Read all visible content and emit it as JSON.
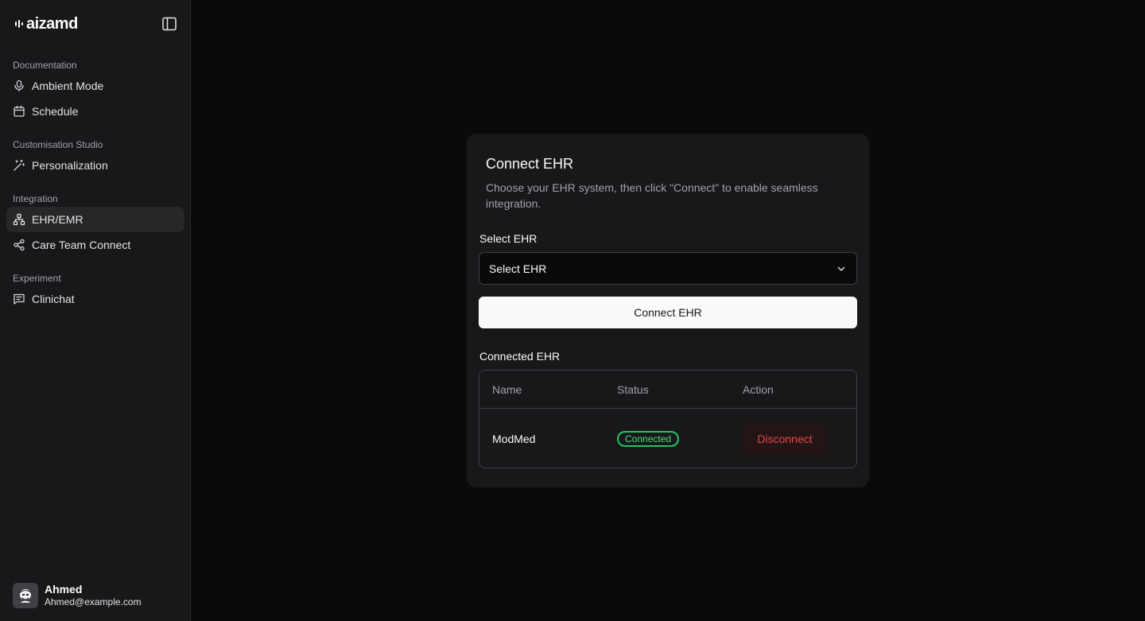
{
  "brand": {
    "name": "aizamd"
  },
  "sidebar": {
    "groups": [
      {
        "label": "Documentation",
        "items": [
          {
            "label": "Ambient Mode",
            "icon": "microphone-icon"
          },
          {
            "label": "Schedule",
            "icon": "calendar-icon"
          }
        ]
      },
      {
        "label": "Customisation Studio",
        "items": [
          {
            "label": "Personalization",
            "icon": "magic-wand-icon"
          }
        ]
      },
      {
        "label": "Integration",
        "items": [
          {
            "label": "EHR/EMR",
            "icon": "network-icon",
            "active": true
          },
          {
            "label": "Care Team Connect",
            "icon": "share-icon"
          }
        ]
      },
      {
        "label": "Experiment",
        "items": [
          {
            "label": "Clinichat",
            "icon": "chat-icon"
          }
        ]
      }
    ]
  },
  "user": {
    "name": "Ahmed",
    "email": "Ahmed@example.com"
  },
  "card": {
    "title": "Connect EHR",
    "description": "Choose your EHR system, then click \"Connect\" to enable seamless integration.",
    "select_label": "Select EHR",
    "select_value": "Select EHR",
    "connect_button": "Connect EHR",
    "connected_label": "Connected EHR",
    "table": {
      "headers": [
        "Name",
        "Status",
        "Action"
      ],
      "rows": [
        {
          "name": "ModMed",
          "status": "Connected",
          "action": "Disconnect"
        }
      ]
    }
  },
  "colors": {
    "accent_success": "#22c55e",
    "accent_danger": "#ef4444",
    "background": "#0a0a0b",
    "surface": "#18181b"
  }
}
